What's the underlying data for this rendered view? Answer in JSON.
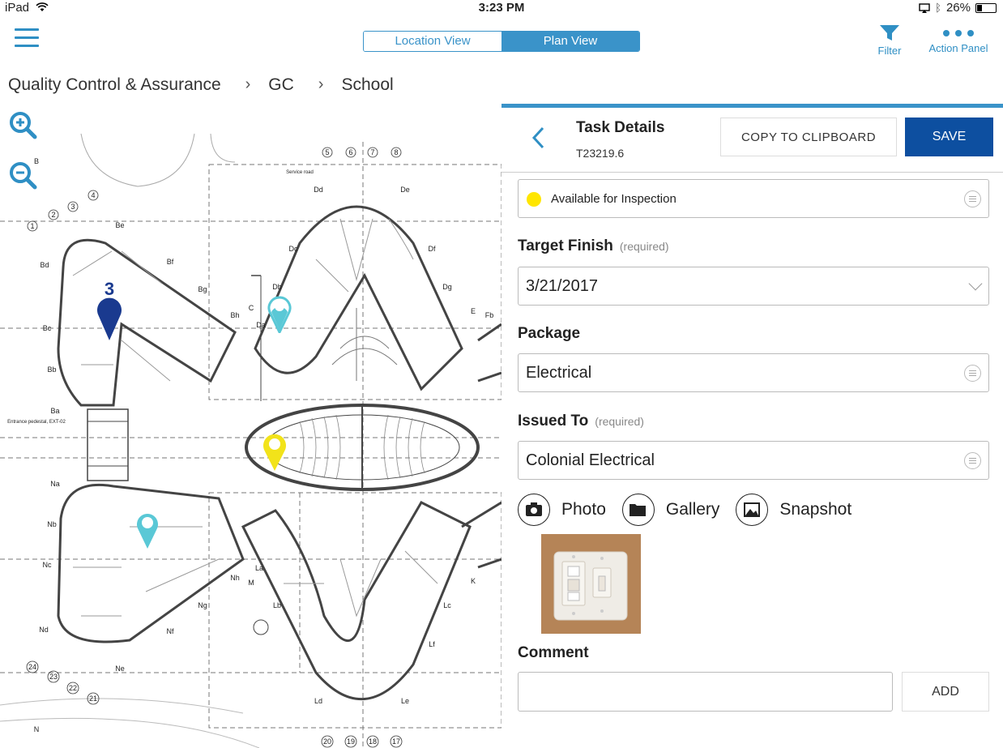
{
  "status_bar": {
    "device": "iPad",
    "time": "3:23 PM",
    "battery": "26%"
  },
  "view_toggle": {
    "location_label": "Location View",
    "plan_label": "Plan View",
    "active": "Plan View"
  },
  "toolbar": {
    "filter_label": "Filter",
    "action_label": "Action Panel",
    "accent": "#2f8fc4"
  },
  "breadcrumb": [
    "Quality Control & Assurance",
    "GC",
    "School"
  ],
  "plan": {
    "pins": [
      {
        "name": "pin-3",
        "label": "3",
        "color": "#1a3a8f"
      },
      {
        "name": "pin-teal-north",
        "color": "#5ac8d6"
      },
      {
        "name": "pin-yellow",
        "color": "#f2e31a"
      },
      {
        "name": "pin-teal-south",
        "color": "#5ac8d6"
      }
    ],
    "grid_labels_top": [
      "5",
      "6",
      "7",
      "8"
    ],
    "grid_labels_bottom": [
      "20",
      "19",
      "18",
      "17"
    ],
    "grid_labels_left": [
      "1",
      "2",
      "3",
      "4",
      "B",
      "Be",
      "Bd",
      "Bf",
      "Bg",
      "Bc",
      "Bb",
      "Bh",
      "Ba",
      "Na",
      "Nb",
      "Nc",
      "Nd",
      "Ne",
      "Nf",
      "Ng",
      "Nh",
      "24",
      "23",
      "22",
      "21",
      "N",
      "M"
    ],
    "grid_labels_mid": [
      "Dd",
      "De",
      "Dc",
      "Df",
      "Db",
      "Dg",
      "C",
      "Da",
      "E",
      "Fb",
      "Lb",
      "Lc",
      "Ld",
      "Le",
      "Lf",
      "K",
      "La"
    ],
    "service_text": "Service road",
    "entrance_text": "Entrance pedestal, EXT-02"
  },
  "task": {
    "title": "Task Details",
    "id": "T23219.6",
    "copy_label": "COPY TO CLIPBOARD",
    "save_label": "SAVE",
    "status": "Available for Inspection",
    "status_color": "#ffe600",
    "target_finish_label": "Target Finish",
    "required_text": "(required)",
    "target_finish_value": "3/21/2017",
    "package_label": "Package",
    "package_value": "Electrical",
    "issued_to_label": "Issued To",
    "issued_to_value": "Colonial Electrical",
    "photo_label": "Photo",
    "gallery_label": "Gallery",
    "snapshot_label": "Snapshot",
    "comment_label": "Comment",
    "comment_value": "",
    "add_label": "ADD",
    "primary_color": "#0d4fa0"
  }
}
